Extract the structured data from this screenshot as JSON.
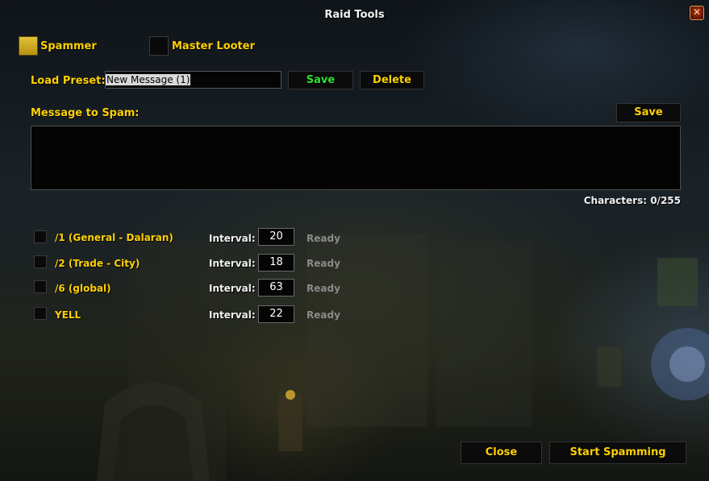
{
  "window": {
    "title": "Raid Tools",
    "close_glyph": "✕"
  },
  "tabs": {
    "spammer_label": "Spammer",
    "master_looter_label": "Master Looter"
  },
  "preset": {
    "label": "Load Preset:",
    "value": "New Message (1)",
    "save_label": "Save",
    "delete_label": "Delete"
  },
  "message": {
    "label": "Message to Spam:",
    "save_label": "Save",
    "text": "",
    "char_count": "Characters: 0/255"
  },
  "channels": [
    {
      "name": "/1 (General - Dalaran)",
      "interval_label": "Interval:",
      "interval": "20",
      "status": "Ready",
      "checked": false
    },
    {
      "name": "/2 (Trade - City)",
      "interval_label": "Interval:",
      "interval": "18",
      "status": "Ready",
      "checked": false
    },
    {
      "name": "/6 (global)",
      "interval_label": "Interval:",
      "interval": "63",
      "status": "Ready",
      "checked": false
    },
    {
      "name": "YELL",
      "interval_label": "Interval:",
      "interval": "22",
      "status": "Ready",
      "checked": false
    }
  ],
  "footer": {
    "close_label": "Close",
    "start_label": "Start Spamming"
  },
  "colors": {
    "gold": "#ffd100",
    "green": "#2ee02e",
    "ready": "#8a8a8a",
    "close_icon": "#b8350f"
  }
}
